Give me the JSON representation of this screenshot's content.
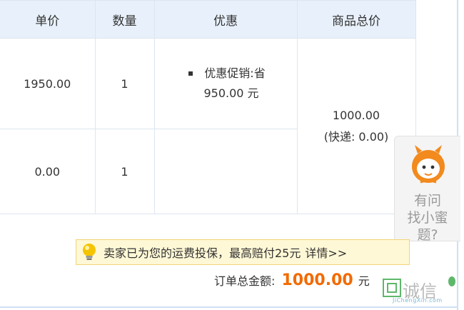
{
  "table": {
    "headers": [
      "单价",
      "数量",
      "优惠",
      "商品总价"
    ],
    "rows": [
      {
        "unit_price": "1950.00",
        "quantity": "1",
        "promo_label": "优惠促销:省",
        "promo_amount": "950.00 元"
      },
      {
        "unit_price": "0.00",
        "quantity": "1"
      }
    ],
    "goods_total": "1000.00",
    "shipping": "(快递: 0.00)"
  },
  "float_widget": {
    "line1": "有问",
    "line2": "找小蜜",
    "line3": "题?"
  },
  "insurance_notice": {
    "text": "卖家已为您的运费投保，最高赔付25元",
    "link": "详情>>",
    "icon": "lightbulb-icon"
  },
  "order_total": {
    "label": "订单总金额:",
    "amount": "1000.00",
    "unit": "元"
  },
  "watermark": {
    "text": "诚信",
    "url": "JiChengXin.com"
  },
  "colors": {
    "header_bg": "#e8f1fb",
    "border": "#dde6ef",
    "amount": "#f26a00",
    "notice_bg": "#fff8d6",
    "notice_border": "#f2d47a",
    "mascot": "#f28a1e"
  }
}
